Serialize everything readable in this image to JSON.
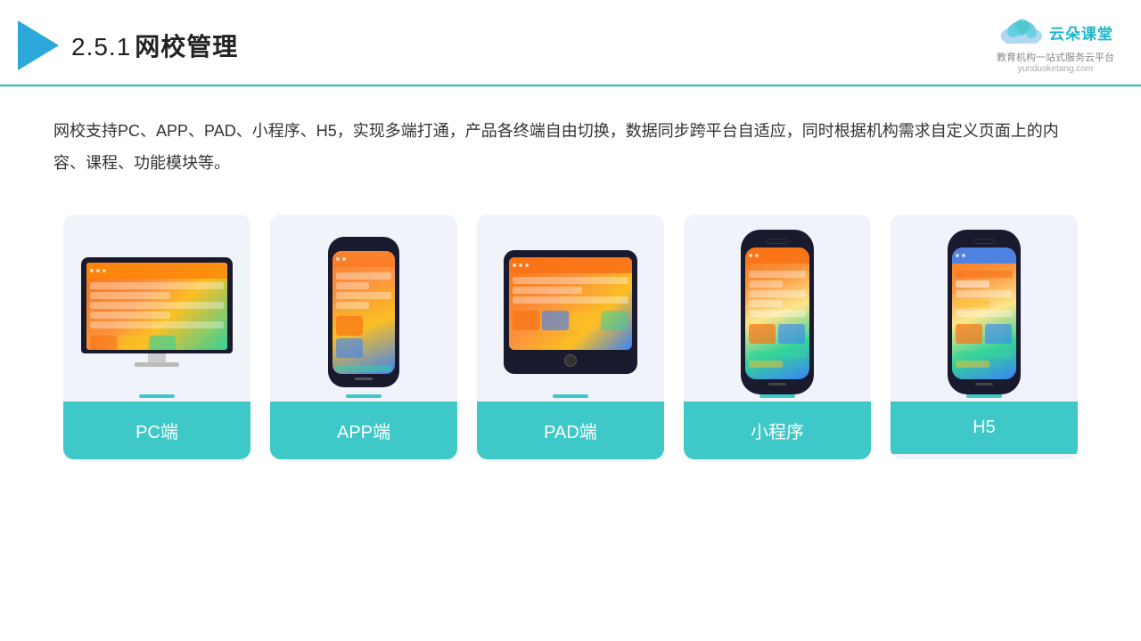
{
  "header": {
    "section_number": "2.5.1",
    "title": "网校管理",
    "brand": {
      "name_cn": "云朵课堂",
      "tagline": "教育机构一站式服务云平台",
      "url": "yunduoketang.com"
    }
  },
  "description": "网校支持PC、APP、PAD、小程序、H5，实现多端打通，产品各终端自由切换，数据同步跨平台自适应，同时根据机构需求自定义页面上的内容、课程、功能模块等。",
  "cards": [
    {
      "id": "pc",
      "label": "PC端"
    },
    {
      "id": "app",
      "label": "APP端"
    },
    {
      "id": "pad",
      "label": "PAD端"
    },
    {
      "id": "miniprogram",
      "label": "小程序"
    },
    {
      "id": "h5",
      "label": "H5"
    }
  ],
  "accent_color": "#3ec8c8",
  "title_color": "#222"
}
